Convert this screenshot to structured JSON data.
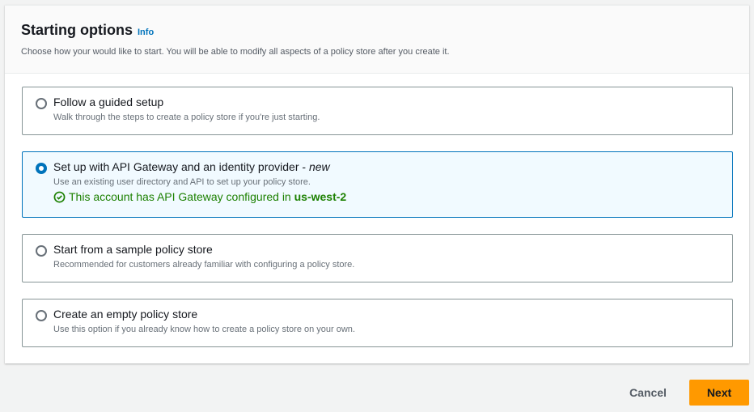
{
  "header": {
    "title": "Starting options",
    "info": "Info",
    "description": "Choose how your would like to start. You will be able to modify all aspects of a policy store after you create it."
  },
  "options": [
    {
      "label": "Follow a guided setup",
      "description": "Walk through the steps to create a policy store if you're just starting.",
      "selected": false
    },
    {
      "label": "Set up with API Gateway and an identity provider - ",
      "label_em": "new",
      "description": "Use an existing user directory and API to set up your policy store.",
      "status_prefix": "This account has API Gateway configured in ",
      "status_region": "us-west-2",
      "selected": true
    },
    {
      "label": "Start from a sample policy store",
      "description": "Recommended for customers already familiar with configuring a policy store.",
      "selected": false
    },
    {
      "label": "Create an empty policy store",
      "description": "Use this option if you already know how to create a policy store on your own.",
      "selected": false
    }
  ],
  "footer": {
    "cancel": "Cancel",
    "next": "Next"
  }
}
